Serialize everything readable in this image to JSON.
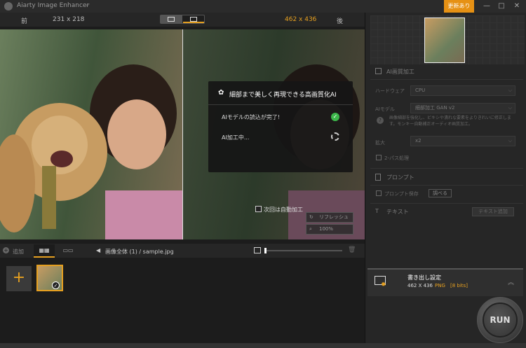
{
  "app": {
    "title": "Aiarty Image Enhancer",
    "update": "更新あり",
    "minimize": "—",
    "maximize": "□",
    "close": "✕"
  },
  "preview": {
    "before": "前",
    "after": "後",
    "src_size": "231 x 218",
    "out_size": "462 x 436"
  },
  "dialog": {
    "title": "細部まで美しく再現できる高画質化AI",
    "line1": "AIモデルの読込が完了!",
    "line2": "AI加工中...",
    "auto": "次回は自動加工",
    "ctrl1": "リフレッシュ",
    "ctrl2": "100%"
  },
  "bottom": {
    "add": "追加",
    "crumb": "画像全体 (1) / sample.jpg"
  },
  "right": {
    "enhance": "AI画質加工",
    "hw_label": "ハードウェア",
    "hw_value": "CPU",
    "model_label": "AIモデル",
    "model_value": "細部加工 GAN v2",
    "model_desc": "画像細部を強化し、ビキシや潰れな要素をよりきれいに修正します。モンキー自動補正オーディオ画質加工。",
    "scale_label": "拡大",
    "scale_value": "x2",
    "twopass": "2-パス処理",
    "prompt": "プロンプト",
    "prompt_save": "プロンプト保存",
    "prompt_view": "調べる",
    "text": "テキスト",
    "text_add": "テキスト追加"
  },
  "export": {
    "title": "書き出し設定",
    "size": "462 X 436",
    "format": "PNG",
    "bits": "[8 bits]"
  },
  "run": "RUN"
}
